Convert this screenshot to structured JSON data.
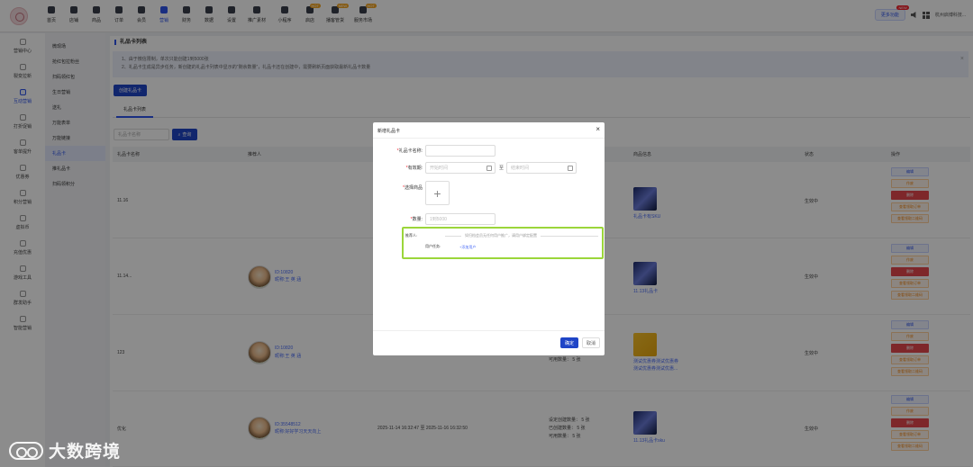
{
  "topnav": {
    "items": [
      "首页",
      "店铺",
      "商品",
      "订单",
      "会员",
      "营销",
      "财务",
      "数据",
      "设置",
      "推广素材",
      "小程序",
      "启店",
      "播客管货",
      "服务市场"
    ],
    "hot_tags": {
      "启店": "HOT",
      "播客管货": "NEW",
      "服务市场": "HOT"
    },
    "more_label": "更多功能",
    "more_badge": "NEW",
    "company": "杭州启博科技..."
  },
  "sidebar1": {
    "items": [
      "营销中心",
      "裂变拉新",
      "互动营销",
      "打折促销",
      "客单提升",
      "优惠券",
      "积分营销",
      "虚拟币",
      "充值优惠",
      "游戏工具",
      "群发助手",
      "智能营销"
    ]
  },
  "sidebar2": {
    "items": [
      "微现场",
      "抢红包拉粉丝",
      "扫码领红包",
      "生日营销",
      "送礼",
      "万能表单",
      "万能链接",
      "礼品卡",
      "推礼品卡",
      "扫码领积分"
    ]
  },
  "main": {
    "title": "礼品卡列表",
    "notice_line1": "1、由于微信限制，单次只能创建1到5000张",
    "notice_line2": "2、礼品卡生成是异步任务，新创建的礼品卡列表中显示的“剩余数量”，礼品卡还在创建中，需要刷新页面获取最新礼品卡数量",
    "create_btn": "创建礼品卡",
    "tab": "礼品卡列表",
    "search_placeholder": "礼品卡名称",
    "search_btn": "查询",
    "headers": [
      "礼品卡名称",
      "推荐人",
      "商品信息",
      "状态",
      "操作"
    ],
    "rows": [
      {
        "name": "11.16",
        "goods": "礼品卡有SKU",
        "status": "生效中"
      },
      {
        "name": "11.14...",
        "uid": "ID:10820",
        "nick": "昵称:王 英 涵",
        "goods": "11.13礼品卡",
        "status": "生效中"
      },
      {
        "name": "123",
        "uid": "ID:10820",
        "nick": "昵称:王 英 涵",
        "qty": "可用数量：  5 张",
        "goods1": "测试优惠券测试优惠券",
        "goods2": "测试优惠券测试优惠...",
        "status": "生效中"
      },
      {
        "name": "优化",
        "uid": "ID:35548512",
        "nick": "昵称:好好学习天天向上",
        "time": "2025-11-14 16:32:47 至 2025-11-16 16:32:50",
        "q1": "设定创建数量： 5 张",
        "q2": "已创建数量：  5 张",
        "q3": "可用数量：   5 张",
        "goods": "11.13礼品卡sku",
        "status": "生效中"
      }
    ],
    "ops": [
      "编辑",
      "作废",
      "删除",
      "查看领取订单",
      "查看领取二维码"
    ]
  },
  "modal": {
    "title": "新增礼品卡",
    "name_label": "礼品卡名称:",
    "validity_label": "有效期:",
    "start_placeholder": "开始时间",
    "sep": "至",
    "end_placeholder": "结束时间",
    "goods_label": "选择商品",
    "qty_label": "数量:",
    "qty_placeholder": "1到5000",
    "referrer_label": "推荐人:",
    "referrer_hint": "如归档会员无任何用户推广，请用户绑定配置",
    "task_label": "用户任务:",
    "add_user": "+添加用户",
    "ok": "确定",
    "cancel": "取消"
  },
  "watermark": "大数跨境"
}
